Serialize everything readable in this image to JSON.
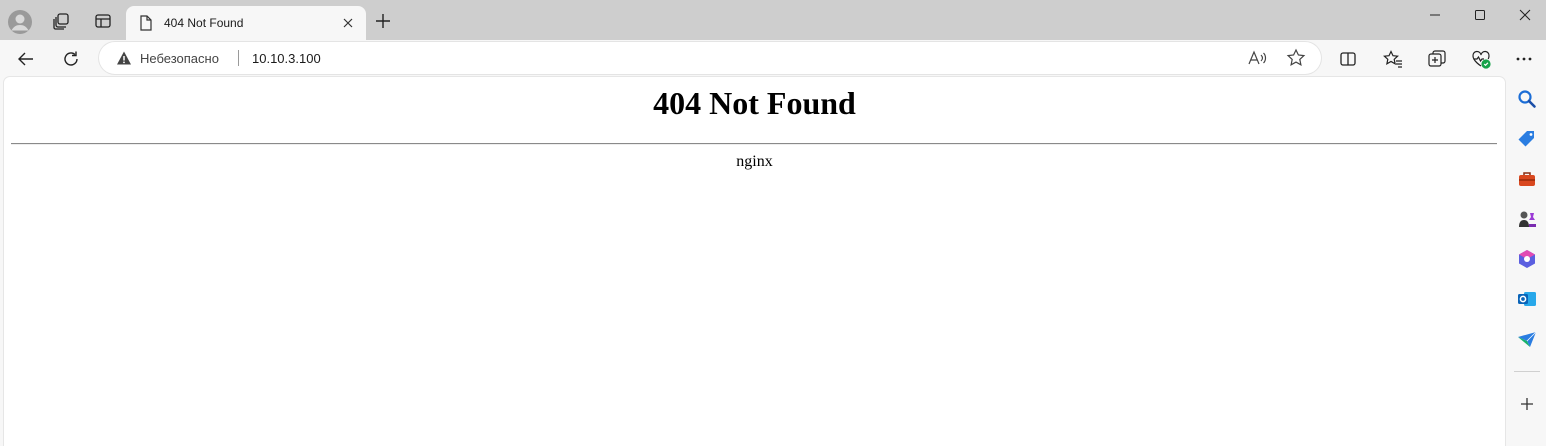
{
  "tab": {
    "title": "404 Not Found"
  },
  "address_bar": {
    "security_label": "Небезопасно",
    "url": "10.10.3.100"
  },
  "page": {
    "heading": "404 Not Found",
    "server": "nginx"
  },
  "icons": {
    "profile": "avatar-icon",
    "workspaces": "workspaces-icon",
    "tab_actions": "tab-actions-icon",
    "favicon": "page-icon",
    "close": "close-icon",
    "new_tab": "plus-icon",
    "back": "back-arrow-icon",
    "reload": "reload-icon",
    "warning": "warning-icon",
    "read_aloud": "read-aloud-icon",
    "favorite": "star-icon",
    "split_screen": "split-screen-icon",
    "favorites": "favorites-icon",
    "collections": "collections-icon",
    "browser_essentials": "heart-pulse-icon",
    "more": "more-icon",
    "sidebar": [
      "search-icon",
      "shopping-tag-icon",
      "tools-icon",
      "games-icon",
      "copilot-icon",
      "outlook-icon",
      "send-icon",
      "plus-icon"
    ]
  },
  "colors": {
    "tabstrip": "#cecece",
    "toolbar": "#f7f7f7",
    "page_bg": "#ffffff",
    "text": "#000000"
  }
}
